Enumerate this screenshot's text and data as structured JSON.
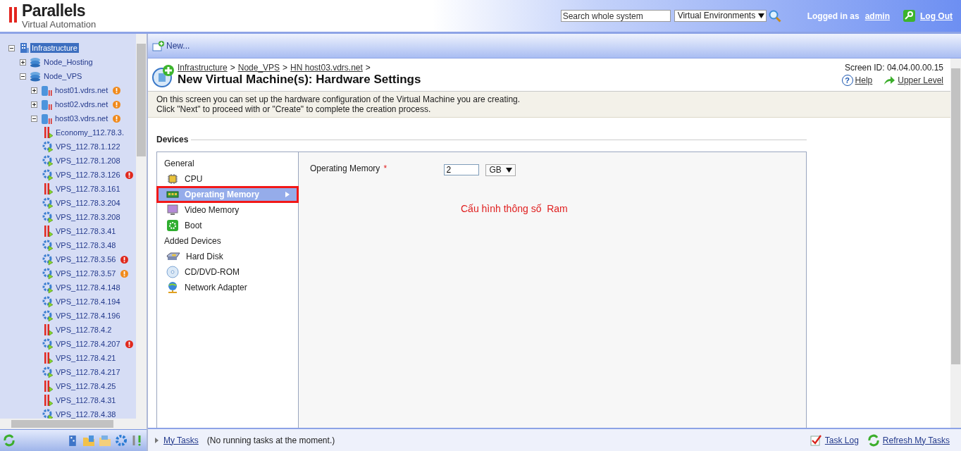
{
  "header": {
    "logo": "Parallels",
    "logo_subtitle": "Virtual Automation",
    "search": {
      "placeholder": "Search whole system"
    },
    "scope_select": {
      "value": "Virtual Environments"
    },
    "logged_in_label": "Logged in as",
    "user": "admin",
    "logout": "Log Out"
  },
  "tree": [
    {
      "label": "Infrastructure",
      "kind": "infrastructure",
      "selected": true,
      "expanded": true,
      "children": [
        {
          "label": "Node_Hosting",
          "kind": "group",
          "selected": false,
          "expanded": false
        },
        {
          "label": "Node_VPS",
          "kind": "group",
          "selected": false,
          "expanded": true,
          "children": [
            {
              "label": "host01.vdrs.net",
              "kind": "host",
              "selected": false,
              "expanded": false,
              "color": "#f08a1c"
            },
            {
              "label": "host02.vdrs.net",
              "kind": "host",
              "selected": false,
              "expanded": false,
              "color": "#f08a1c"
            },
            {
              "label": "host03.vdrs.net",
              "kind": "host",
              "selected": false,
              "expanded": true,
              "color": "#f08a1c",
              "children": [
                {
                  "label": "Economy_112.78.3.",
                  "kind": "vm_stopped",
                  "selected": false
                },
                {
                  "label": "VPS_112.78.1.122",
                  "kind": "vm_running",
                  "selected": false
                },
                {
                  "label": "VPS_112.78.1.208",
                  "kind": "vm_running",
                  "selected": false
                },
                {
                  "label": "VPS_112.78.3.126",
                  "kind": "vm_running",
                  "selected": false,
                  "color": "#e0281c"
                },
                {
                  "label": "VPS_112.78.3.161",
                  "kind": "vm_stopped",
                  "selected": false
                },
                {
                  "label": "VPS_112.78.3.204",
                  "kind": "vm_running",
                  "selected": false
                },
                {
                  "label": "VPS_112.78.3.208",
                  "kind": "vm_running",
                  "selected": false
                },
                {
                  "label": "VPS_112.78.3.41",
                  "kind": "vm_stopped",
                  "selected": false
                },
                {
                  "label": "VPS_112.78.3.48",
                  "kind": "vm_running",
                  "selected": false
                },
                {
                  "label": "VPS_112.78.3.56",
                  "kind": "vm_running",
                  "selected": false,
                  "color": "#e0281c"
                },
                {
                  "label": "VPS_112.78.3.57",
                  "kind": "vm_running",
                  "selected": false,
                  "color": "#f08a1c"
                },
                {
                  "label": "VPS_112.78.4.148",
                  "kind": "vm_running",
                  "selected": false
                },
                {
                  "label": "VPS_112.78.4.194",
                  "kind": "vm_running",
                  "selected": false
                },
                {
                  "label": "VPS_112.78.4.196",
                  "kind": "vm_running",
                  "selected": false
                },
                {
                  "label": "VPS_112.78.4.2",
                  "kind": "vm_stopped",
                  "selected": false
                },
                {
                  "label": "VPS_112.78.4.207",
                  "kind": "vm_running",
                  "selected": false,
                  "color": "#e0281c"
                },
                {
                  "label": "VPS_112.78.4.21",
                  "kind": "vm_stopped",
                  "selected": false
                },
                {
                  "label": "VPS_112.78.4.217",
                  "kind": "vm_running",
                  "selected": false
                },
                {
                  "label": "VPS_112.78.4.25",
                  "kind": "vm_stopped",
                  "selected": false
                },
                {
                  "label": "VPS_112.78.4.31",
                  "kind": "vm_stopped",
                  "selected": false
                },
                {
                  "label": "VPS_112.78.4.38",
                  "kind": "vm_running",
                  "selected": false
                }
              ]
            }
          ]
        }
      ]
    }
  ],
  "toolbar": {
    "new_button": "New..."
  },
  "page": {
    "breadcrumb": [
      {
        "kind": "link",
        "text": "Infrastructure"
      },
      {
        "kind": "separator",
        "text": ">"
      },
      {
        "kind": "link",
        "text": "Node_VPS"
      },
      {
        "kind": "separator",
        "text": ">"
      },
      {
        "kind": "link",
        "text": "HN host03.vdrs.net"
      },
      {
        "kind": "separator",
        "text": ">"
      }
    ],
    "title": "New Virtual Machine(s): Hardware Settings",
    "screen_id": "Screen ID: 04.04.00.00.15",
    "help_icon": "?",
    "help": "Help",
    "upper_level": "Upper Level",
    "description": [
      "On this screen you can set up the hardware configuration of the Virtual Machine you are creating.",
      "Click \"Next\" to proceed with or \"Create\" to complete the creation process."
    ]
  },
  "devices": {
    "title": "Devices",
    "items": [
      {
        "kind": "heading",
        "label": "General"
      },
      {
        "kind": "cpu",
        "label": "CPU",
        "selected": false,
        "annotated": false
      },
      {
        "kind": "memory",
        "label": "Operating Memory",
        "selected": true,
        "annotated": true
      },
      {
        "kind": "video",
        "label": "Video Memory",
        "selected": false,
        "annotated": false
      },
      {
        "kind": "boot",
        "label": "Boot",
        "selected": false,
        "annotated": false
      },
      {
        "kind": "heading",
        "label": "Added Devices"
      },
      {
        "kind": "disk",
        "label": "Hard Disk",
        "selected": false,
        "annotated": false
      },
      {
        "kind": "cd",
        "label": "CD/DVD-ROM",
        "selected": false,
        "annotated": false
      },
      {
        "kind": "network",
        "label": "Network Adapter",
        "selected": false,
        "annotated": false
      }
    ],
    "form": {
      "label": "Operating Memory",
      "required_mark": "*",
      "value": "2",
      "unit": "GB"
    },
    "annotation": "Cấu hình thông số  Ram"
  },
  "taskbar": {
    "my_tasks": "My Tasks",
    "status": "(No running tasks at the moment.)",
    "task_log": "Task Log",
    "refresh": "Refresh My Tasks"
  }
}
